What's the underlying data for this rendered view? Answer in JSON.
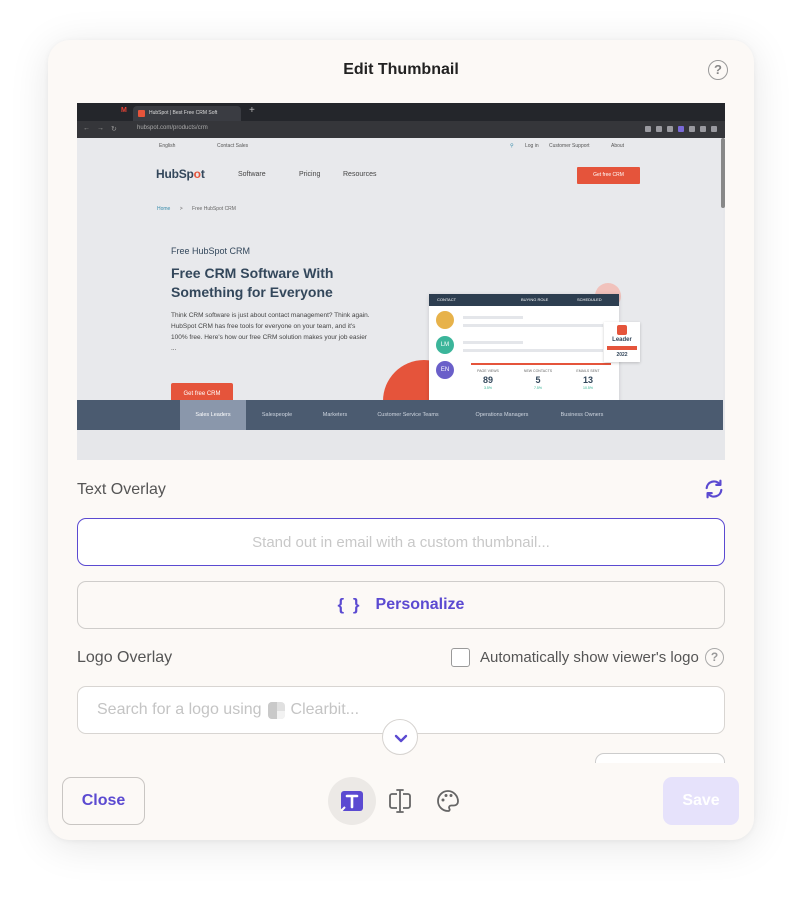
{
  "modal": {
    "title": "Edit Thumbnail",
    "help_glyph": "?"
  },
  "preview": {
    "browser": {
      "gmail_glyph": "M",
      "tab_title": "HubSpot | Best Free CRM Soft",
      "new_tab": "+",
      "url": "hubspot.com/products/crm"
    },
    "utility": {
      "language": "English",
      "contact": "Contact Sales",
      "login": "Log in",
      "support": "Customer Support",
      "about": "About"
    },
    "logo": {
      "pre": "HubSp",
      "o": "o",
      "post": "t"
    },
    "menu": [
      "Software",
      "Pricing",
      "Resources"
    ],
    "cta_top": "Get free CRM",
    "breadcrumb": {
      "home": "Home",
      "sep": ">",
      "current": "Free HubSpot CRM"
    },
    "eyebrow": "Free HubSpot CRM",
    "headline": "Free CRM Software With Something for Everyone",
    "body": "Think CRM software is just about contact management? Think again. HubSpot CRM has free tools for everyone on your team, and it's 100% free. Here's how our free CRM solution makes your job easier ...",
    "cta_main": "Get free CRM",
    "card": {
      "cols": [
        "CONTACT",
        "BUYING ROLE",
        "SCHEDULED"
      ],
      "avatars": [
        "",
        "LM",
        "EN"
      ],
      "stats": [
        {
          "label": "PAGE VIEWS",
          "value": "89",
          "change": "3.5%"
        },
        {
          "label": "NEW CONTACTS",
          "value": "5",
          "change": "7.5%"
        },
        {
          "label": "EMAILS SENT",
          "value": "13",
          "change": "10.5%"
        }
      ]
    },
    "badge": {
      "title": "Leader",
      "year": "2022"
    },
    "tabs": [
      "Sales Leaders",
      "Salespeople",
      "Marketers",
      "Customer Service Teams",
      "Operations Managers",
      "Business Owners"
    ],
    "active_tab": "Sales Leaders"
  },
  "text_overlay": {
    "label": "Text Overlay",
    "placeholder": "Stand out in email with a custom thumbnail...",
    "value": ""
  },
  "personalize": {
    "braces": "{ }",
    "label": "Personalize"
  },
  "logo_overlay": {
    "label": "Logo Overlay",
    "auto_label": "Automatically show viewer's logo",
    "auto_checked": false,
    "search_prefix": "Search for a logo using",
    "search_brand": "Clearbit..."
  },
  "footer": {
    "close": "Close",
    "save": "Save",
    "tools": [
      "text-tool-icon",
      "layout-tool-icon",
      "palette-tool-icon"
    ],
    "active_tool": "text-tool-icon"
  },
  "colors": {
    "accent": "#5b4ad1",
    "hubspot_orange": "#e5543b",
    "save_disabled": "#e6e2fb",
    "modal_bg": "#fcf9f6"
  }
}
